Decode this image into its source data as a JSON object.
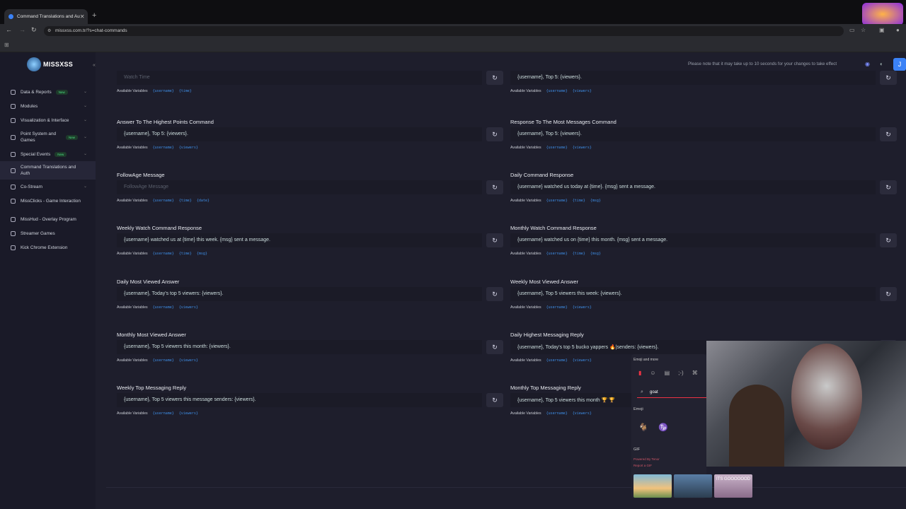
{
  "browser": {
    "tab_title": "Command Translations and Au",
    "url": "missxss.com.tr/?s=chat-commands",
    "new_tab": "+",
    "close": "✕"
  },
  "brand": {
    "name": "MISSXSS"
  },
  "topbar": {
    "note": "Please note that it may take up to 10 seconds for your changes to take effect",
    "avatar": "J"
  },
  "sidebar": {
    "items": [
      {
        "label": "Data & Reports",
        "badge": "New",
        "chevron": "⌄"
      },
      {
        "label": "Modules",
        "badge": "",
        "chevron": "⌄"
      },
      {
        "label": "Visualization & Interface",
        "badge": "",
        "chevron": "⌄"
      },
      {
        "label": "Point System and Games",
        "badge": "New",
        "chevron": "⌄"
      },
      {
        "label": "Special Events",
        "badge": "New",
        "chevron": "⌄"
      },
      {
        "label": "Command Translations and Auth",
        "badge": "",
        "chevron": ""
      },
      {
        "label": "Co-Stream",
        "badge": "",
        "chevron": "⌄"
      },
      {
        "label": "MissClicks - Game Interaction",
        "badge": "",
        "chevron": ""
      },
      {
        "label": "MissHud - Overlay Program",
        "badge": "",
        "chevron": ""
      },
      {
        "label": "Streamer Games",
        "badge": "",
        "chevron": ""
      },
      {
        "label": "Kick Chrome Extension",
        "badge": "",
        "chevron": ""
      }
    ]
  },
  "common": {
    "available_variables": "Available Variables",
    "reset_icon": "↻"
  },
  "fields": [
    {
      "title": "",
      "value": "",
      "placeholder": "Watch Time",
      "vars": [
        "{username}",
        "{time}"
      ]
    },
    {
      "title": "",
      "value": "{username}, Top 5: {viewers}.",
      "placeholder": "",
      "vars": [
        "{username}",
        "{viewers}"
      ]
    },
    {
      "title": "Answer To The Highest Points Command",
      "value": "{username}, Top 5: {viewers}.",
      "placeholder": "",
      "vars": [
        "{username}",
        "{viewers}"
      ]
    },
    {
      "title": "Response To The Most Messages Command",
      "value": "{username}, Top 5: {viewers}.",
      "placeholder": "",
      "vars": [
        "{username}",
        "{viewers}"
      ]
    },
    {
      "title": "FollowAge Message",
      "value": "",
      "placeholder": "FollowAge Message",
      "vars": [
        "{username}",
        "{time}",
        "{date}"
      ]
    },
    {
      "title": "Daily Command Response",
      "value": "{username} watched us today at {time}. {msg} sent a message.",
      "placeholder": "",
      "vars": [
        "{username}",
        "{time}",
        "{msg}"
      ]
    },
    {
      "title": "Weekly Watch Command Response",
      "value": "{username} watched us at {time} this week. {msg} sent a message.",
      "placeholder": "",
      "vars": [
        "{username}",
        "{time}",
        "{msg}"
      ]
    },
    {
      "title": "Monthly Watch Command Response",
      "value": "{username} watched us on {time} this month. {msg} sent a message.",
      "placeholder": "",
      "vars": [
        "{username}",
        "{time}",
        "{msg}"
      ]
    },
    {
      "title": "Daily Most Viewed Answer",
      "value": "{username}, Today's top 5 viewers: {viewers}.",
      "placeholder": "",
      "vars": [
        "{username}",
        "{viewers}"
      ]
    },
    {
      "title": "Weekly Most Viewed Answer",
      "value": "{username}, Top 5 viewers this week: {viewers}.",
      "placeholder": "",
      "vars": [
        "{username}",
        "{viewers}"
      ]
    },
    {
      "title": "Monthly Most Viewed Answer",
      "value": "{username}, Top 5 viewers this month: {viewers}.",
      "placeholder": "",
      "vars": [
        "{username}",
        "{viewers}"
      ]
    },
    {
      "title": "Daily Highest Messaging Reply",
      "value": "{username}, Today's top 5  bucko yappers 🔥|senders: {viewers}.",
      "placeholder": "",
      "vars": [
        "{username}",
        "{viewers}"
      ]
    },
    {
      "title": "Weekly Top Messaging Reply",
      "value": "{username}, Top 5 viewers this message senders: {viewers}.",
      "placeholder": "",
      "vars": [
        "{username}",
        "{viewers}"
      ]
    },
    {
      "title": "Monthly Top Messaging Reply",
      "value": "{username}, Top 5 viewers this month 🏆 🏆",
      "placeholder": "",
      "vars": [
        "{username}",
        "{viewers}"
      ]
    }
  ],
  "emoji_picker": {
    "title": "Emoji and more",
    "search": "goat",
    "emoji_label": "Emoji",
    "gif_label": "GIF",
    "powered": "Powered By Tenor",
    "report": "Report a GIF",
    "results": [
      "🐐",
      "♑"
    ],
    "gif_text": "ITS GOOOOOOD"
  }
}
